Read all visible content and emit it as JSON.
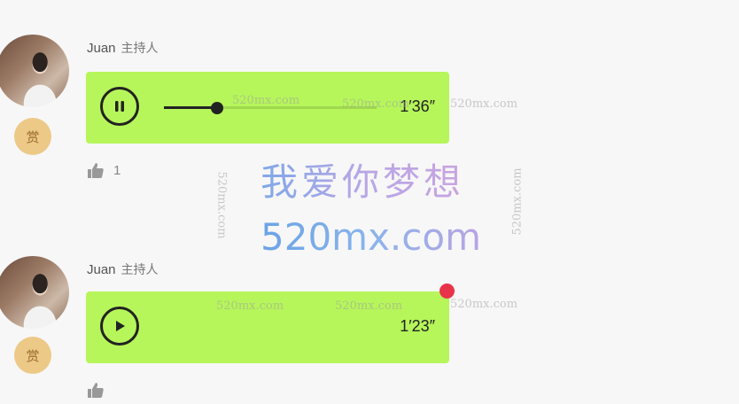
{
  "messages": [
    {
      "sender": "Juan",
      "role": "主持人",
      "tip_label": "赏",
      "state": "playing",
      "progress_fraction": 0.25,
      "duration": "1′36″",
      "likes": "1",
      "unread": false
    },
    {
      "sender": "Juan",
      "role": "主持人",
      "tip_label": "赏",
      "state": "paused",
      "duration": "1′23″",
      "likes": "",
      "unread": true
    }
  ],
  "watermark": {
    "site": "520mx.com",
    "slogan": "我爱你梦想"
  },
  "colors": {
    "bubble": "#b6f65a",
    "unread_dot": "#e8344b",
    "tip_badge": "#edc987"
  }
}
